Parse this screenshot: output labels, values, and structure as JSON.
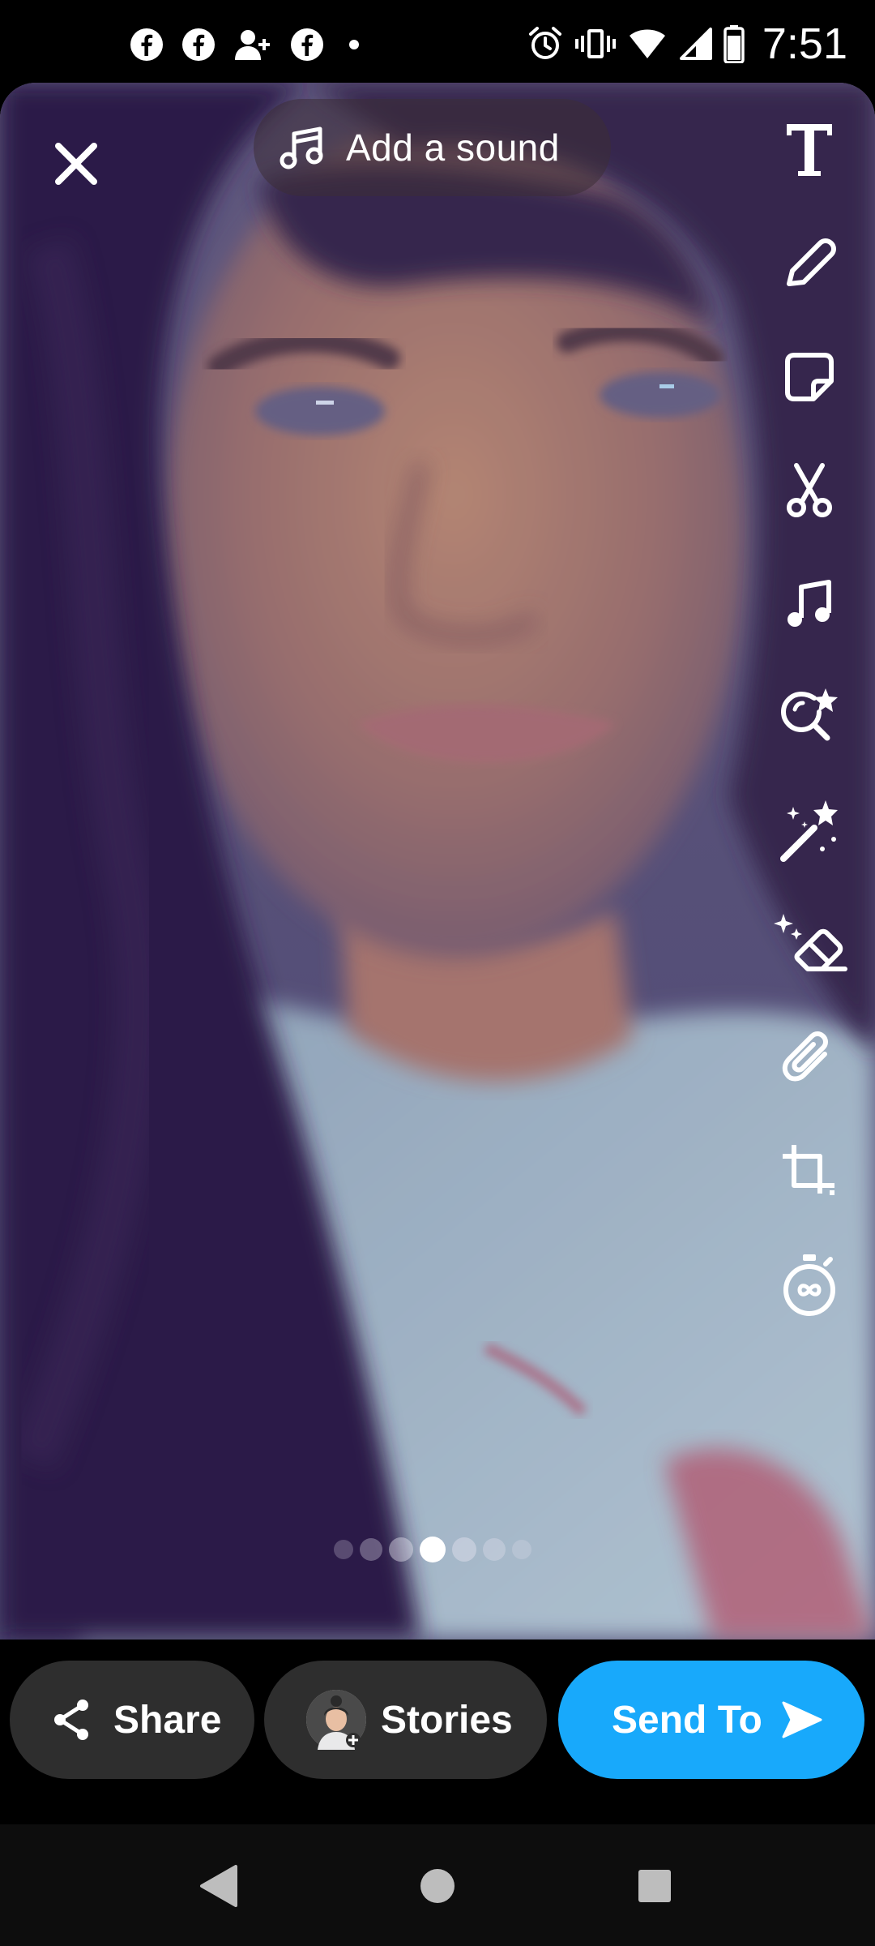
{
  "status_bar": {
    "time": "7:51",
    "notification_icons": [
      "facebook-icon",
      "facebook-icon",
      "add-friend-icon",
      "facebook-icon",
      "dot-icon"
    ],
    "system_icons": [
      "alarm-icon",
      "vibrate-icon",
      "wifi-icon",
      "signal-icon",
      "battery-icon"
    ]
  },
  "editor": {
    "close_icon": "close-icon",
    "sound_button": {
      "label": "Add a sound",
      "icon": "music-note-icon"
    },
    "tools": [
      {
        "name": "text-tool",
        "icon": "text-icon"
      },
      {
        "name": "draw-tool",
        "icon": "pencil-icon"
      },
      {
        "name": "sticker-tool",
        "icon": "sticker-icon"
      },
      {
        "name": "scissors-tool",
        "icon": "scissors-icon"
      },
      {
        "name": "music-tool",
        "icon": "music-note-icon"
      },
      {
        "name": "lens-tool",
        "icon": "lens-search-icon"
      },
      {
        "name": "magic-tool",
        "icon": "magic-wand-icon"
      },
      {
        "name": "eraser-tool",
        "icon": "magic-eraser-icon"
      },
      {
        "name": "attach-tool",
        "icon": "paperclip-icon"
      },
      {
        "name": "crop-tool",
        "icon": "crop-icon"
      },
      {
        "name": "timer-tool",
        "icon": "infinity-timer-icon"
      }
    ],
    "page_dots": {
      "count": 7,
      "active_index": 3
    }
  },
  "actions": {
    "share_label": "Share",
    "stories_label": "Stories",
    "send_label": "Send To"
  },
  "colors": {
    "send_button": "#18a9fb",
    "pill_background": "#2e2e2e",
    "background": "#000000"
  },
  "nav": {
    "icons": [
      "back-icon",
      "home-icon",
      "recents-icon"
    ]
  }
}
